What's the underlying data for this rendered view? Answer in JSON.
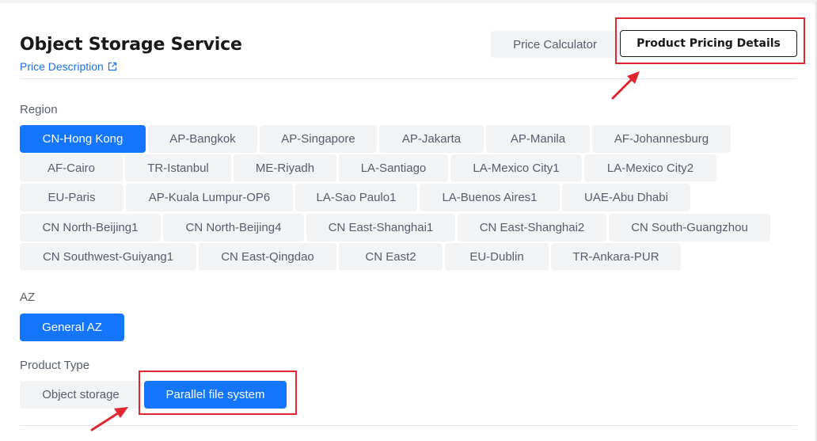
{
  "header": {
    "title": "Object Storage Service",
    "price_description": "Price Description",
    "price_calculator": "Price Calculator",
    "product_pricing_details": "Product Pricing Details"
  },
  "region": {
    "label": "Region",
    "selected": "CN-Hong Kong",
    "options": [
      "CN-Hong Kong",
      "AP-Bangkok",
      "AP-Singapore",
      "AP-Jakarta",
      "AP-Manila",
      "AF-Johannesburg",
      "AF-Cairo",
      "TR-Istanbul",
      "ME-Riyadh",
      "LA-Santiago",
      "LA-Mexico City1",
      "LA-Mexico City2",
      "EU-Paris",
      "AP-Kuala Lumpur-OP6",
      "LA-Sao Paulo1",
      "LA-Buenos Aires1",
      "UAE-Abu Dhabi",
      "CN North-Beijing1",
      "CN North-Beijing4",
      "CN East-Shanghai1",
      "CN East-Shanghai2",
      "CN South-Guangzhou",
      "CN Southwest-Guiyang1",
      "CN East-Qingdao",
      "CN East2",
      "EU-Dublin",
      "TR-Ankara-PUR"
    ]
  },
  "az": {
    "label": "AZ",
    "options": [
      "General AZ"
    ]
  },
  "product_type": {
    "label": "Product Type",
    "selected": "Parallel file system",
    "options": [
      "Object storage",
      "Parallel file system"
    ]
  },
  "colors": {
    "accent": "#1476ff",
    "link": "#1f6feb",
    "highlight": "#e0262f"
  },
  "icons": {
    "price_description": "external-link-icon",
    "annotation": "red-arrow-icon"
  }
}
